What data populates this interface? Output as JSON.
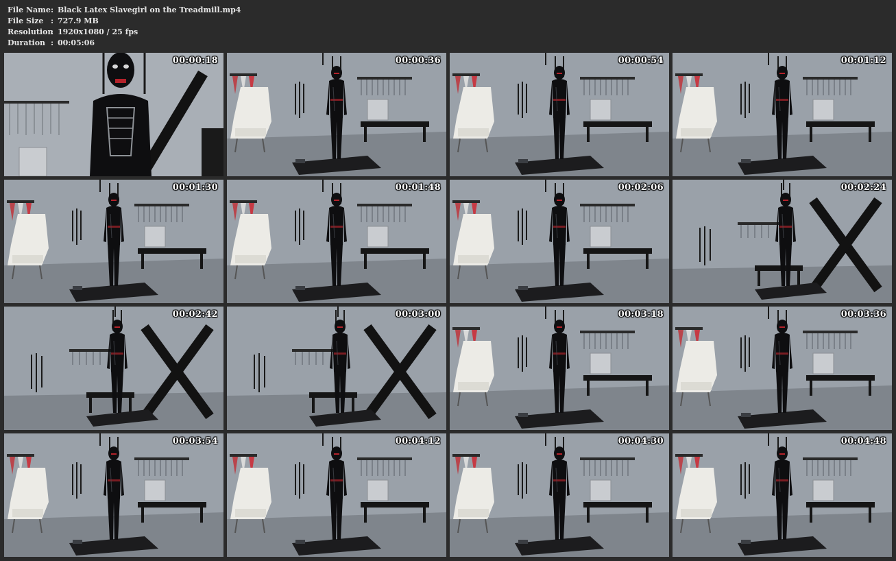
{
  "info": {
    "rows": [
      {
        "key": "File Name",
        "sep": ":",
        "value": "Black Latex Slavegirl on the Treadmill.mp4"
      },
      {
        "key": "File Size",
        "sep": ":",
        "value": "727.9 MB"
      },
      {
        "key": "Resolution",
        "sep": ":",
        "value": "1920x1080 / 25 fps"
      },
      {
        "key": "Duration",
        "sep": ":",
        "value": "00:05:06"
      }
    ]
  },
  "thumbnails": [
    {
      "timestamp": "00:00:18",
      "scene": "closeup"
    },
    {
      "timestamp": "00:00:36",
      "scene": "treadmill"
    },
    {
      "timestamp": "00:00:54",
      "scene": "treadmill"
    },
    {
      "timestamp": "00:01:12",
      "scene": "treadmill"
    },
    {
      "timestamp": "00:01:30",
      "scene": "treadmill"
    },
    {
      "timestamp": "00:01:48",
      "scene": "treadmill"
    },
    {
      "timestamp": "00:02:06",
      "scene": "treadmill"
    },
    {
      "timestamp": "00:02:24",
      "scene": "cross"
    },
    {
      "timestamp": "00:02:42",
      "scene": "cross"
    },
    {
      "timestamp": "00:03:00",
      "scene": "cross"
    },
    {
      "timestamp": "00:03:18",
      "scene": "treadmill"
    },
    {
      "timestamp": "00:03:36",
      "scene": "treadmill"
    },
    {
      "timestamp": "00:03:54",
      "scene": "treadmill"
    },
    {
      "timestamp": "00:04:12",
      "scene": "treadmill"
    },
    {
      "timestamp": "00:04:30",
      "scene": "treadmill"
    },
    {
      "timestamp": "00:04:48",
      "scene": "treadmill"
    }
  ],
  "colors": {
    "page_background": "#2b2b2b",
    "wall": "#9aa1a9",
    "floor": "#7f858c",
    "latex": "#0e0e10",
    "chair": "#ecebe6",
    "timestamp_text": "#ffffff"
  }
}
